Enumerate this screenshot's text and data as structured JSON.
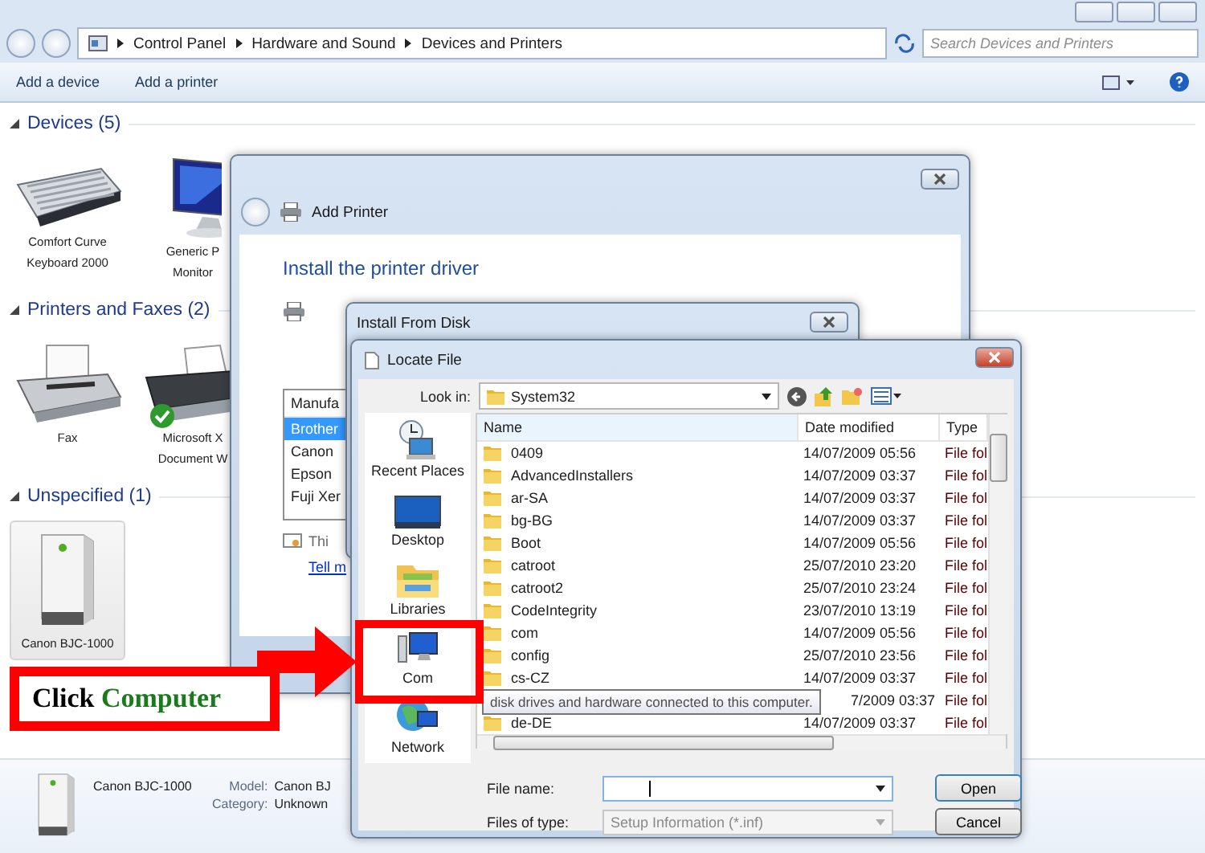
{
  "explorer": {
    "breadcrumbs": [
      "Control Panel",
      "Hardware and Sound",
      "Devices and Printers"
    ],
    "search": {
      "placeholder": "Search Devices and Printers"
    },
    "toolbar": [
      "Add a device",
      "Add a printer"
    ],
    "groups": [
      {
        "title": "Devices (5)",
        "expanded": true,
        "items": [
          {
            "kind": "keyboard",
            "lines": [
              "Comfort Curve",
              "Keyboard 2000"
            ],
            "selected": false,
            "default": false
          },
          {
            "kind": "monitor",
            "lines": [
              "Generic P",
              "Monitor"
            ],
            "selected": false,
            "default": false
          }
        ]
      },
      {
        "title": "Printers and Faxes (2)",
        "expanded": true,
        "items": [
          {
            "kind": "fax",
            "lines": [
              "Fax"
            ],
            "selected": false,
            "default": false
          },
          {
            "kind": "printer",
            "lines": [
              "Microsoft X",
              "Document W"
            ],
            "selected": false,
            "default": true
          }
        ]
      },
      {
        "title": "Unspecified (1)",
        "expanded": true,
        "items": [
          {
            "kind": "tower",
            "lines": [
              "Canon BJC-1000"
            ],
            "selected": true,
            "default": false
          }
        ]
      }
    ],
    "details": {
      "name": "Canon BJC-1000",
      "fields": [
        {
          "label": "Model:",
          "value": "Canon BJ"
        },
        {
          "label": "Category:",
          "value": "Unknown"
        }
      ]
    }
  },
  "add_printer": {
    "title": "Add Printer",
    "heading": "Install the printer driver",
    "list_header": "Manufa",
    "manufacturers": [
      {
        "label": "Brother",
        "selected": true
      },
      {
        "label": "Canon",
        "selected": false
      },
      {
        "label": "Epson",
        "selected": false
      },
      {
        "label": "Fuji Xer",
        "selected": false
      }
    ],
    "note": "Thi",
    "link": "Tell m"
  },
  "install_from_disk": {
    "title": "Install From Disk"
  },
  "locate_file": {
    "title": "Locate File",
    "look_in_label": "Look in:",
    "look_in": "System32",
    "places": [
      {
        "kind": "recent",
        "label": "Recent Places"
      },
      {
        "kind": "desktop",
        "label": "Desktop"
      },
      {
        "kind": "libraries",
        "label": "Libraries"
      },
      {
        "kind": "computer",
        "label": "Com"
      },
      {
        "kind": "network",
        "label": "Network"
      }
    ],
    "columns": [
      "Name",
      "Date modified",
      "Type"
    ],
    "rows": [
      {
        "name": "0409",
        "date": "14/07/2009 05:56",
        "type": "File fol"
      },
      {
        "name": "AdvancedInstallers",
        "date": "14/07/2009 03:37",
        "type": "File fol"
      },
      {
        "name": "ar-SA",
        "date": "14/07/2009 03:37",
        "type": "File fol"
      },
      {
        "name": "bg-BG",
        "date": "14/07/2009 03:37",
        "type": "File fol"
      },
      {
        "name": "Boot",
        "date": "14/07/2009 05:56",
        "type": "File fol"
      },
      {
        "name": "catroot",
        "date": "25/07/2010 23:20",
        "type": "File fol"
      },
      {
        "name": "catroot2",
        "date": "25/07/2010 23:24",
        "type": "File fol"
      },
      {
        "name": "CodeIntegrity",
        "date": "23/07/2010 13:19",
        "type": "File fol"
      },
      {
        "name": "com",
        "date": "14/07/2009 05:56",
        "type": "File fol"
      },
      {
        "name": "config",
        "date": "25/07/2010 23:56",
        "type": "File fol"
      },
      {
        "name": "cs-CZ",
        "date": "14/07/2009 03:37",
        "type": "File fol"
      },
      {
        "date": "7/2009 03:37",
        "type": "File fol"
      },
      {
        "name": "de-DE",
        "date": "14/07/2009 03:37",
        "type": "File fol"
      }
    ],
    "file_name_label": "File name:",
    "files_of_type_label": "Files of type:",
    "files_of_type": "Setup Information (*.inf)",
    "buttons": [
      "Open",
      "Cancel"
    ],
    "tooltip": "disk drives and hardware connected to this computer."
  },
  "callout": {
    "parts": [
      {
        "text": "Click",
        "color": "#000000"
      },
      {
        "text": "Computer",
        "color": "#1b7a1b"
      }
    ]
  }
}
